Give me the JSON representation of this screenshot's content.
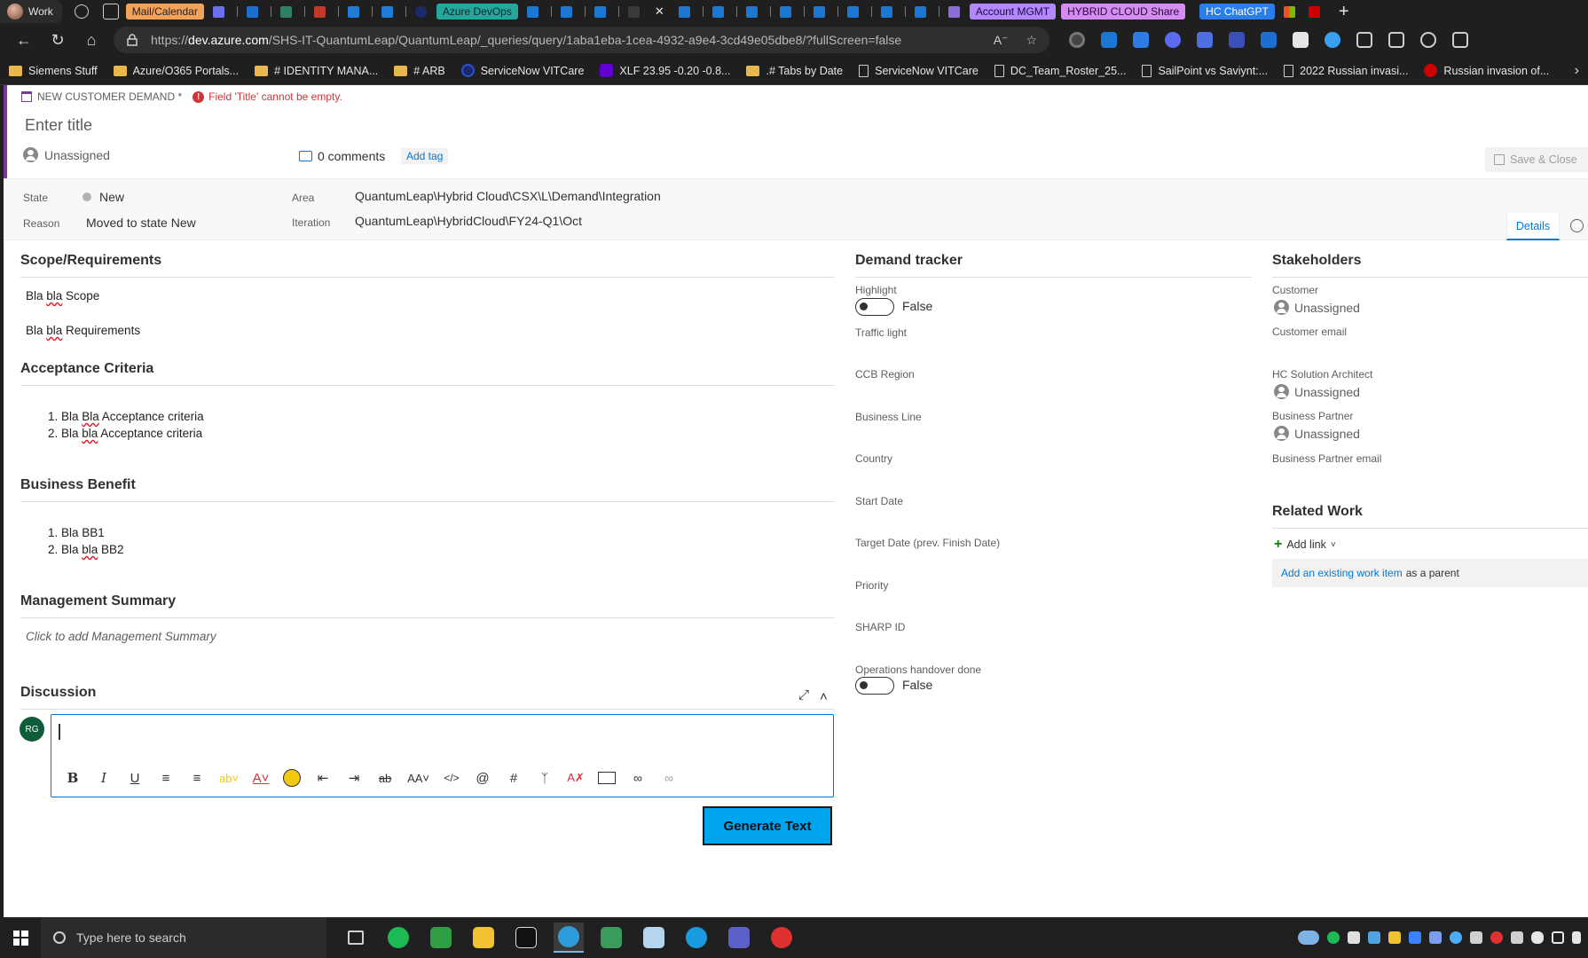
{
  "browser": {
    "profile_label": "Work",
    "tabs": [
      {
        "label": "Mail/Calendar",
        "color": "#f4a259"
      },
      {
        "label": "Azure DevOps",
        "color": "#26a69a"
      },
      {
        "label": "Account MGMT",
        "color": "#b388ff"
      },
      {
        "label": "HYBRID CLOUD Share",
        "color": "#d58cf2"
      },
      {
        "label": "HC ChatGPT",
        "color": "#2b7de9"
      }
    ],
    "close_glyph": "✕",
    "newtab_glyph": "+",
    "url_prefix": "https://",
    "url_host": "dev.azure.com",
    "url_path": "/SHS-IT-QuantumLeap/QuantumLeap/_queries/query/1aba1eba-1cea-4932-a9e4-3cd49e05dbe8/?fullScreen=false",
    "bookmarks": [
      {
        "label": "Siemens Stuff",
        "icon": "folder-icon"
      },
      {
        "label": "Azure/O365 Portals...",
        "icon": "folder-icon"
      },
      {
        "label": "# IDENTITY MANA...",
        "icon": "folder-icon"
      },
      {
        "label": "# ARB",
        "icon": "folder-icon"
      },
      {
        "label": "ServiceNow VITCare",
        "icon": "servicenow-icon"
      },
      {
        "label": "XLF 23.95 -0.20 -0.8...",
        "icon": "yahoo-icon"
      },
      {
        "label": ".# Tabs by Date",
        "icon": "folder-icon"
      },
      {
        "label": "ServiceNow VITCare",
        "icon": "page-icon"
      },
      {
        "label": "DC_Team_Roster_25...",
        "icon": "page-icon"
      },
      {
        "label": "SailPoint vs Saviynt:...",
        "icon": "page-icon"
      },
      {
        "label": "2022 Russian invasi...",
        "icon": "page-icon"
      },
      {
        "label": "Russian invasion of...",
        "icon": "cnn-icon"
      }
    ]
  },
  "workitem": {
    "type_label": "NEW CUSTOMER DEMAND *",
    "error_text": "Field 'Title' cannot be empty.",
    "title_placeholder": "Enter title",
    "assigned": "Unassigned",
    "comments": "0 comments",
    "add_tag": "Add tag",
    "save_close": "Save & Close",
    "state_label": "State",
    "state_value": "New",
    "reason_label": "Reason",
    "reason_value": "Moved to state New",
    "area_label": "Area",
    "area_value": "QuantumLeap\\Hybrid Cloud\\CSX\\L\\Demand\\Integration",
    "iteration_label": "Iteration",
    "iteration_value": "QuantumLeap\\HybridCloud\\FY24-Q1\\Oct",
    "details_tab": "Details"
  },
  "scope": {
    "heading": "Scope/Requirements",
    "line1_a": "Bla ",
    "line1_b": "bla",
    "line1_c": " Scope",
    "line2_a": "Bla ",
    "line2_b": "bla",
    "line2_c": " Requirements"
  },
  "acceptance": {
    "heading": "Acceptance Criteria",
    "item1_a": "1. Bla ",
    "item1_b": "Bla",
    "item1_c": " Acceptance criteria",
    "item2_a": "2. Bla ",
    "item2_b": "bla",
    "item2_c": " Acceptance criteria"
  },
  "benefit": {
    "heading": "Business Benefit",
    "item1": "1. Bla BB1",
    "item2_a": "2. Bla ",
    "item2_b": "bla",
    "item2_c": " BB2"
  },
  "management": {
    "heading": "Management Summary",
    "placeholder": "Click to add Management Summary"
  },
  "discussion": {
    "heading": "Discussion",
    "avatar_initials": "RG",
    "expand_glyph": "⤢",
    "collapse_glyph": "˄",
    "generate_label": "Generate Text"
  },
  "demand": {
    "heading": "Demand tracker",
    "highlight_label": "Highlight",
    "highlight_value": "False",
    "traffic_light": "Traffic light",
    "ccb_region": "CCB Region",
    "business_line": "Business Line",
    "country": "Country",
    "start_date": "Start Date",
    "target_date": "Target Date (prev. Finish Date)",
    "priority": "Priority",
    "sharp_id": "SHARP ID",
    "ops_label": "Operations handover done",
    "ops_value": "False"
  },
  "stakeholders": {
    "heading": "Stakeholders",
    "customer_label": "Customer",
    "customer_value": "Unassigned",
    "customer_email": "Customer email",
    "architect_label": "HC Solution Architect",
    "architect_value": "Unassigned",
    "partner_label": "Business Partner",
    "partner_value": "Unassigned",
    "partner_email": "Business Partner email"
  },
  "related": {
    "heading": "Related Work",
    "add_link": "Add link",
    "add_existing": "Add an existing work item",
    "as_parent": "as a parent"
  },
  "taskbar": {
    "search_placeholder": "Type here to search"
  }
}
